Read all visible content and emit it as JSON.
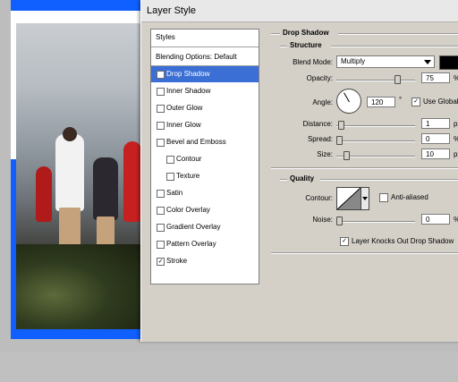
{
  "dialog": {
    "title": "Layer Style"
  },
  "styles_list": {
    "header": "Styles",
    "blending": "Blending Options: Default",
    "items": [
      {
        "label": "Drop Shadow",
        "checked": true,
        "selected": true
      },
      {
        "label": "Inner Shadow",
        "checked": false
      },
      {
        "label": "Outer Glow",
        "checked": false
      },
      {
        "label": "Inner Glow",
        "checked": false
      },
      {
        "label": "Bevel and Emboss",
        "checked": false
      },
      {
        "label": "Contour",
        "checked": false
      },
      {
        "label": "Texture",
        "checked": false
      },
      {
        "label": "Satin",
        "checked": false
      },
      {
        "label": "Color Overlay",
        "checked": false
      },
      {
        "label": "Gradient Overlay",
        "checked": false
      },
      {
        "label": "Pattern Overlay",
        "checked": false
      },
      {
        "label": "Stroke",
        "checked": true
      }
    ]
  },
  "drop_shadow": {
    "section_title": "Drop Shadow",
    "structure": {
      "title": "Structure",
      "blend_mode_label": "Blend Mode:",
      "blend_mode_value": "Multiply",
      "shadow_color": "#000000",
      "opacity_label": "Opacity:",
      "opacity_value": "75",
      "opacity_unit": "%",
      "angle_label": "Angle:",
      "angle_value": "120",
      "angle_unit": "°",
      "use_global_label": "Use Global",
      "use_global_checked": true,
      "distance_label": "Distance:",
      "distance_value": "1",
      "distance_unit": "px",
      "spread_label": "Spread:",
      "spread_value": "0",
      "spread_unit": "%",
      "size_label": "Size:",
      "size_value": "10",
      "size_unit": "px"
    },
    "quality": {
      "title": "Quality",
      "contour_label": "Contour:",
      "anti_aliased_label": "Anti-aliased",
      "anti_aliased_checked": false,
      "noise_label": "Noise:",
      "noise_value": "0",
      "noise_unit": "%",
      "knockout_label": "Layer Knocks Out Drop Shadow",
      "knockout_checked": true
    }
  },
  "colors": {
    "canvas_blue": "#1060ff",
    "selection": "#3b6fd6"
  }
}
